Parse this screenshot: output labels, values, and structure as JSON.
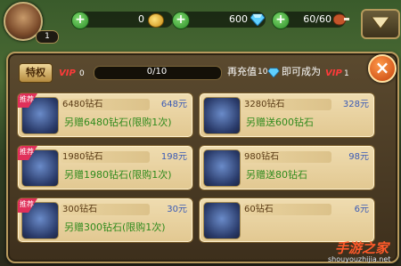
{
  "hud": {
    "avatar_level": "1",
    "coins": "0",
    "gems": "600",
    "stamina": "60/60"
  },
  "panel": {
    "privilege_button": "特权",
    "vip_label": "VIP",
    "current_vip": "0",
    "progress": {
      "text": "0/10",
      "fraction": 0.0
    },
    "recharge_prefix": "再充值",
    "recharge_amount": "10",
    "recharge_suffix": "即可成为",
    "next_vip_label": "VIP",
    "next_vip": "1",
    "close_label": "×"
  },
  "items": [
    {
      "recommended": true,
      "recommended_label": "推荐",
      "name": "6480钻石",
      "price": "648元",
      "bonus": "另赠6480钻石(限购1次)",
      "icon": "gem-chest-icon"
    },
    {
      "recommended": false,
      "recommended_label": "",
      "name": "3280钻石",
      "price": "328元",
      "bonus": "另赠送600钻石",
      "icon": "gem-bowl-icon"
    },
    {
      "recommended": true,
      "recommended_label": "推荐",
      "name": "1980钻石",
      "price": "198元",
      "bonus": "另赠1980钻石(限购1次)",
      "icon": "gem-bowl-icon"
    },
    {
      "recommended": false,
      "recommended_label": "",
      "name": "980钻石",
      "price": "98元",
      "bonus": "另赠送80钻石",
      "icon": "gem-pile-icon"
    },
    {
      "recommended": true,
      "recommended_label": "推荐",
      "name": "300钻石",
      "price": "30元",
      "bonus": "另赠300钻石(限购1次)",
      "icon": "gem-pile-icon"
    },
    {
      "recommended": false,
      "recommended_label": "",
      "name": "60钻石",
      "price": "6元",
      "bonus": "",
      "icon": "gem-single-icon"
    }
  ],
  "watermark": {
    "title": "手游之家",
    "url": "shouyouzhijia.net"
  },
  "colors": {
    "vip": "#ff3a3a",
    "price": "#3a5ab5",
    "bonus": "#2f8a1c",
    "accent_orange": "#e4561a"
  }
}
